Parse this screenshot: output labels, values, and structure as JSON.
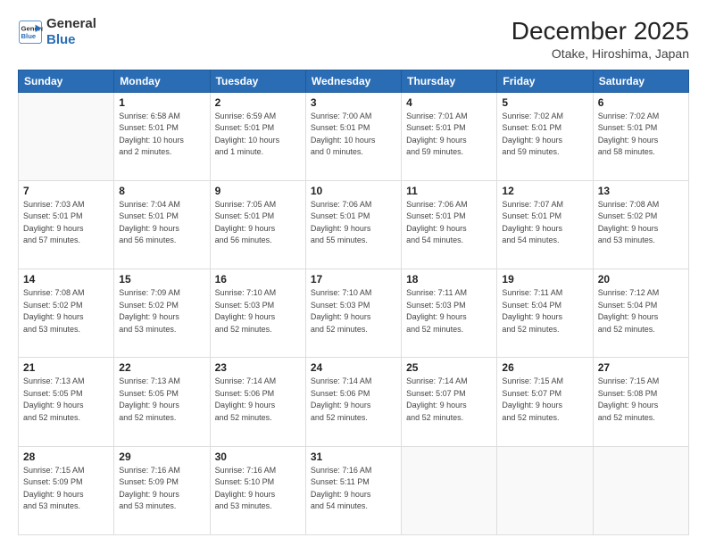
{
  "logo": {
    "line1": "General",
    "line2": "Blue"
  },
  "title": "December 2025",
  "subtitle": "Otake, Hiroshima, Japan",
  "weekdays": [
    "Sunday",
    "Monday",
    "Tuesday",
    "Wednesday",
    "Thursday",
    "Friday",
    "Saturday"
  ],
  "weeks": [
    [
      {
        "day": "",
        "info": ""
      },
      {
        "day": "1",
        "info": "Sunrise: 6:58 AM\nSunset: 5:01 PM\nDaylight: 10 hours\nand 2 minutes."
      },
      {
        "day": "2",
        "info": "Sunrise: 6:59 AM\nSunset: 5:01 PM\nDaylight: 10 hours\nand 1 minute."
      },
      {
        "day": "3",
        "info": "Sunrise: 7:00 AM\nSunset: 5:01 PM\nDaylight: 10 hours\nand 0 minutes."
      },
      {
        "day": "4",
        "info": "Sunrise: 7:01 AM\nSunset: 5:01 PM\nDaylight: 9 hours\nand 59 minutes."
      },
      {
        "day": "5",
        "info": "Sunrise: 7:02 AM\nSunset: 5:01 PM\nDaylight: 9 hours\nand 59 minutes."
      },
      {
        "day": "6",
        "info": "Sunrise: 7:02 AM\nSunset: 5:01 PM\nDaylight: 9 hours\nand 58 minutes."
      }
    ],
    [
      {
        "day": "7",
        "info": "Sunrise: 7:03 AM\nSunset: 5:01 PM\nDaylight: 9 hours\nand 57 minutes."
      },
      {
        "day": "8",
        "info": "Sunrise: 7:04 AM\nSunset: 5:01 PM\nDaylight: 9 hours\nand 56 minutes."
      },
      {
        "day": "9",
        "info": "Sunrise: 7:05 AM\nSunset: 5:01 PM\nDaylight: 9 hours\nand 56 minutes."
      },
      {
        "day": "10",
        "info": "Sunrise: 7:06 AM\nSunset: 5:01 PM\nDaylight: 9 hours\nand 55 minutes."
      },
      {
        "day": "11",
        "info": "Sunrise: 7:06 AM\nSunset: 5:01 PM\nDaylight: 9 hours\nand 54 minutes."
      },
      {
        "day": "12",
        "info": "Sunrise: 7:07 AM\nSunset: 5:01 PM\nDaylight: 9 hours\nand 54 minutes."
      },
      {
        "day": "13",
        "info": "Sunrise: 7:08 AM\nSunset: 5:02 PM\nDaylight: 9 hours\nand 53 minutes."
      }
    ],
    [
      {
        "day": "14",
        "info": "Sunrise: 7:08 AM\nSunset: 5:02 PM\nDaylight: 9 hours\nand 53 minutes."
      },
      {
        "day": "15",
        "info": "Sunrise: 7:09 AM\nSunset: 5:02 PM\nDaylight: 9 hours\nand 53 minutes."
      },
      {
        "day": "16",
        "info": "Sunrise: 7:10 AM\nSunset: 5:03 PM\nDaylight: 9 hours\nand 52 minutes."
      },
      {
        "day": "17",
        "info": "Sunrise: 7:10 AM\nSunset: 5:03 PM\nDaylight: 9 hours\nand 52 minutes."
      },
      {
        "day": "18",
        "info": "Sunrise: 7:11 AM\nSunset: 5:03 PM\nDaylight: 9 hours\nand 52 minutes."
      },
      {
        "day": "19",
        "info": "Sunrise: 7:11 AM\nSunset: 5:04 PM\nDaylight: 9 hours\nand 52 minutes."
      },
      {
        "day": "20",
        "info": "Sunrise: 7:12 AM\nSunset: 5:04 PM\nDaylight: 9 hours\nand 52 minutes."
      }
    ],
    [
      {
        "day": "21",
        "info": "Sunrise: 7:13 AM\nSunset: 5:05 PM\nDaylight: 9 hours\nand 52 minutes."
      },
      {
        "day": "22",
        "info": "Sunrise: 7:13 AM\nSunset: 5:05 PM\nDaylight: 9 hours\nand 52 minutes."
      },
      {
        "day": "23",
        "info": "Sunrise: 7:14 AM\nSunset: 5:06 PM\nDaylight: 9 hours\nand 52 minutes."
      },
      {
        "day": "24",
        "info": "Sunrise: 7:14 AM\nSunset: 5:06 PM\nDaylight: 9 hours\nand 52 minutes."
      },
      {
        "day": "25",
        "info": "Sunrise: 7:14 AM\nSunset: 5:07 PM\nDaylight: 9 hours\nand 52 minutes."
      },
      {
        "day": "26",
        "info": "Sunrise: 7:15 AM\nSunset: 5:07 PM\nDaylight: 9 hours\nand 52 minutes."
      },
      {
        "day": "27",
        "info": "Sunrise: 7:15 AM\nSunset: 5:08 PM\nDaylight: 9 hours\nand 52 minutes."
      }
    ],
    [
      {
        "day": "28",
        "info": "Sunrise: 7:15 AM\nSunset: 5:09 PM\nDaylight: 9 hours\nand 53 minutes."
      },
      {
        "day": "29",
        "info": "Sunrise: 7:16 AM\nSunset: 5:09 PM\nDaylight: 9 hours\nand 53 minutes."
      },
      {
        "day": "30",
        "info": "Sunrise: 7:16 AM\nSunset: 5:10 PM\nDaylight: 9 hours\nand 53 minutes."
      },
      {
        "day": "31",
        "info": "Sunrise: 7:16 AM\nSunset: 5:11 PM\nDaylight: 9 hours\nand 54 minutes."
      },
      {
        "day": "",
        "info": ""
      },
      {
        "day": "",
        "info": ""
      },
      {
        "day": "",
        "info": ""
      }
    ]
  ]
}
